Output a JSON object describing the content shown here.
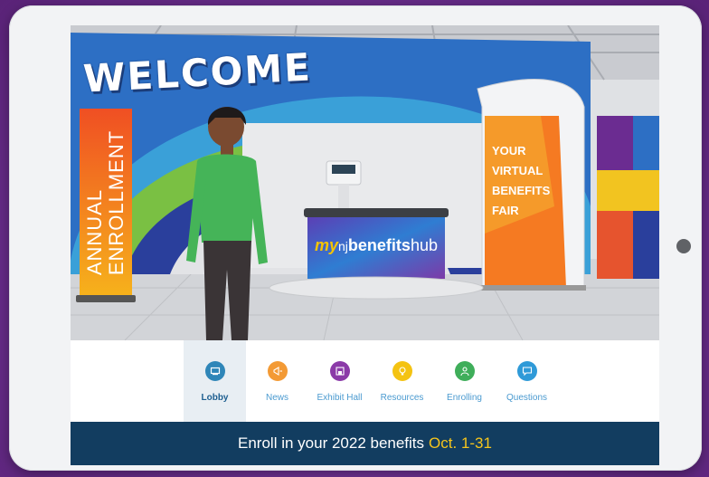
{
  "scene": {
    "welcome_text": "WELCOME",
    "banner_lines": [
      "ANNUAL",
      "ENROLLMENT"
    ],
    "fair_lines": [
      "YOUR",
      "VIRTUAL",
      "BENEFITS",
      "FAIR"
    ],
    "logo": {
      "my": "my",
      "nj": "nj",
      "benefits": "benefits",
      "hub": "hub"
    }
  },
  "nav": {
    "items": [
      {
        "label": "Lobby",
        "icon": "lobby-icon",
        "color": "#2f86b8",
        "active": true
      },
      {
        "label": "News",
        "icon": "megaphone-icon",
        "color": "#f39a35",
        "active": false
      },
      {
        "label": "Exhibit Hall",
        "icon": "exhibit-booth-icon",
        "color": "#8b3aa8",
        "active": false
      },
      {
        "label": "Resources",
        "icon": "lightbulb-icon",
        "color": "#f4c312",
        "active": false
      },
      {
        "label": "Enrolling",
        "icon": "people-icon",
        "color": "#3fae5a",
        "active": false
      },
      {
        "label": "Questions",
        "icon": "chat-icon",
        "color": "#2f9ad8",
        "active": false
      }
    ]
  },
  "footer": {
    "text": "Enroll in your 2022 benefits",
    "highlight": "Oct. 1-31"
  },
  "colors": {
    "frame_purple": "#6b2f8f",
    "footer_navy": "#123d60",
    "footer_highlight": "#f6c51c",
    "nav_label_blue": "#4a9ad0"
  }
}
